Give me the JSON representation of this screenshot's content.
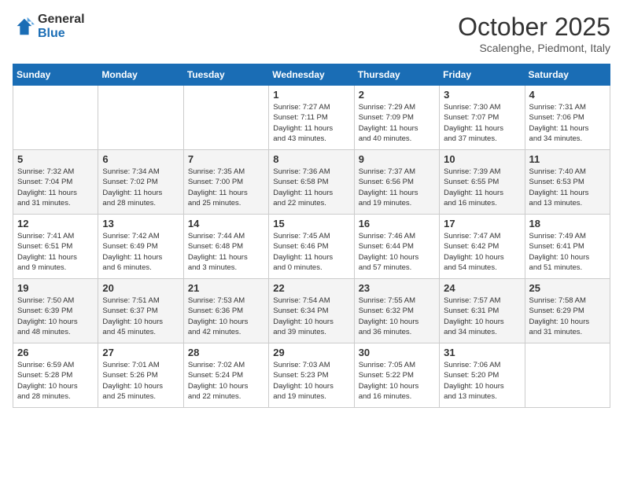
{
  "logo": {
    "line1": "General",
    "line2": "Blue"
  },
  "title": "October 2025",
  "subtitle": "Scalenghe, Piedmont, Italy",
  "weekdays": [
    "Sunday",
    "Monday",
    "Tuesday",
    "Wednesday",
    "Thursday",
    "Friday",
    "Saturday"
  ],
  "weeks": [
    [
      {
        "day": "",
        "info": ""
      },
      {
        "day": "",
        "info": ""
      },
      {
        "day": "",
        "info": ""
      },
      {
        "day": "1",
        "info": "Sunrise: 7:27 AM\nSunset: 7:11 PM\nDaylight: 11 hours\nand 43 minutes."
      },
      {
        "day": "2",
        "info": "Sunrise: 7:29 AM\nSunset: 7:09 PM\nDaylight: 11 hours\nand 40 minutes."
      },
      {
        "day": "3",
        "info": "Sunrise: 7:30 AM\nSunset: 7:07 PM\nDaylight: 11 hours\nand 37 minutes."
      },
      {
        "day": "4",
        "info": "Sunrise: 7:31 AM\nSunset: 7:06 PM\nDaylight: 11 hours\nand 34 minutes."
      }
    ],
    [
      {
        "day": "5",
        "info": "Sunrise: 7:32 AM\nSunset: 7:04 PM\nDaylight: 11 hours\nand 31 minutes."
      },
      {
        "day": "6",
        "info": "Sunrise: 7:34 AM\nSunset: 7:02 PM\nDaylight: 11 hours\nand 28 minutes."
      },
      {
        "day": "7",
        "info": "Sunrise: 7:35 AM\nSunset: 7:00 PM\nDaylight: 11 hours\nand 25 minutes."
      },
      {
        "day": "8",
        "info": "Sunrise: 7:36 AM\nSunset: 6:58 PM\nDaylight: 11 hours\nand 22 minutes."
      },
      {
        "day": "9",
        "info": "Sunrise: 7:37 AM\nSunset: 6:56 PM\nDaylight: 11 hours\nand 19 minutes."
      },
      {
        "day": "10",
        "info": "Sunrise: 7:39 AM\nSunset: 6:55 PM\nDaylight: 11 hours\nand 16 minutes."
      },
      {
        "day": "11",
        "info": "Sunrise: 7:40 AM\nSunset: 6:53 PM\nDaylight: 11 hours\nand 13 minutes."
      }
    ],
    [
      {
        "day": "12",
        "info": "Sunrise: 7:41 AM\nSunset: 6:51 PM\nDaylight: 11 hours\nand 9 minutes."
      },
      {
        "day": "13",
        "info": "Sunrise: 7:42 AM\nSunset: 6:49 PM\nDaylight: 11 hours\nand 6 minutes."
      },
      {
        "day": "14",
        "info": "Sunrise: 7:44 AM\nSunset: 6:48 PM\nDaylight: 11 hours\nand 3 minutes."
      },
      {
        "day": "15",
        "info": "Sunrise: 7:45 AM\nSunset: 6:46 PM\nDaylight: 11 hours\nand 0 minutes."
      },
      {
        "day": "16",
        "info": "Sunrise: 7:46 AM\nSunset: 6:44 PM\nDaylight: 10 hours\nand 57 minutes."
      },
      {
        "day": "17",
        "info": "Sunrise: 7:47 AM\nSunset: 6:42 PM\nDaylight: 10 hours\nand 54 minutes."
      },
      {
        "day": "18",
        "info": "Sunrise: 7:49 AM\nSunset: 6:41 PM\nDaylight: 10 hours\nand 51 minutes."
      }
    ],
    [
      {
        "day": "19",
        "info": "Sunrise: 7:50 AM\nSunset: 6:39 PM\nDaylight: 10 hours\nand 48 minutes."
      },
      {
        "day": "20",
        "info": "Sunrise: 7:51 AM\nSunset: 6:37 PM\nDaylight: 10 hours\nand 45 minutes."
      },
      {
        "day": "21",
        "info": "Sunrise: 7:53 AM\nSunset: 6:36 PM\nDaylight: 10 hours\nand 42 minutes."
      },
      {
        "day": "22",
        "info": "Sunrise: 7:54 AM\nSunset: 6:34 PM\nDaylight: 10 hours\nand 39 minutes."
      },
      {
        "day": "23",
        "info": "Sunrise: 7:55 AM\nSunset: 6:32 PM\nDaylight: 10 hours\nand 36 minutes."
      },
      {
        "day": "24",
        "info": "Sunrise: 7:57 AM\nSunset: 6:31 PM\nDaylight: 10 hours\nand 34 minutes."
      },
      {
        "day": "25",
        "info": "Sunrise: 7:58 AM\nSunset: 6:29 PM\nDaylight: 10 hours\nand 31 minutes."
      }
    ],
    [
      {
        "day": "26",
        "info": "Sunrise: 6:59 AM\nSunset: 5:28 PM\nDaylight: 10 hours\nand 28 minutes."
      },
      {
        "day": "27",
        "info": "Sunrise: 7:01 AM\nSunset: 5:26 PM\nDaylight: 10 hours\nand 25 minutes."
      },
      {
        "day": "28",
        "info": "Sunrise: 7:02 AM\nSunset: 5:24 PM\nDaylight: 10 hours\nand 22 minutes."
      },
      {
        "day": "29",
        "info": "Sunrise: 7:03 AM\nSunset: 5:23 PM\nDaylight: 10 hours\nand 19 minutes."
      },
      {
        "day": "30",
        "info": "Sunrise: 7:05 AM\nSunset: 5:22 PM\nDaylight: 10 hours\nand 16 minutes."
      },
      {
        "day": "31",
        "info": "Sunrise: 7:06 AM\nSunset: 5:20 PM\nDaylight: 10 hours\nand 13 minutes."
      },
      {
        "day": "",
        "info": ""
      }
    ]
  ]
}
